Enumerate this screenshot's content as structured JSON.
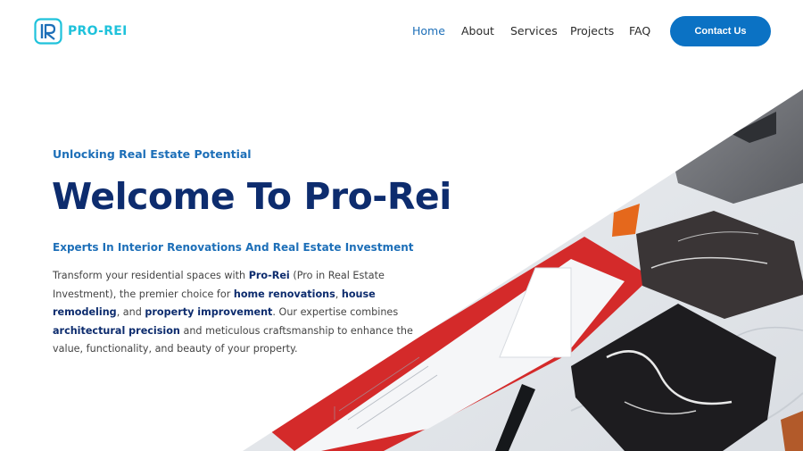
{
  "brand": {
    "name": "PRO-REI",
    "accent": "#1fc2db",
    "primary": "#0b72c4",
    "navy": "#0d2c6e"
  },
  "nav": {
    "items": [
      {
        "label": "Home",
        "active": true
      },
      {
        "label": "About",
        "active": false
      },
      {
        "label": "Services",
        "active": false
      },
      {
        "label": "Projects",
        "active": false
      },
      {
        "label": "FAQ",
        "active": false
      }
    ],
    "cta_label": "Contact Us"
  },
  "hero": {
    "eyebrow": "Unlocking Real Estate Potential",
    "title": "Welcome To Pro-Rei",
    "subtitle": "Experts In Interior Renovations And Real Estate Investment",
    "body": {
      "p1": "Transform your residential spaces with ",
      "b1": "Pro-Rei",
      "p2": " (Pro in Real Estate Investment), the premier choice for ",
      "b2": "home renovations",
      "p3": ", ",
      "b3": "house remodeling",
      "p4": ", and ",
      "b4": "property improvement",
      "p5": ". Our expertise combines ",
      "b5": "architectural precision",
      "p6": " and meticulous craftsmanship to enhance the value, functionality, and beauty of your property."
    }
  }
}
